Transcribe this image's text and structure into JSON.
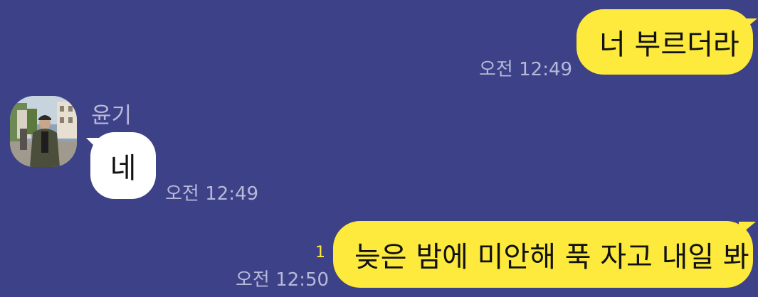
{
  "messages": [
    {
      "direction": "outgoing",
      "text": "너 부르더라",
      "time": "오전 12:49"
    },
    {
      "direction": "incoming",
      "sender": "윤기",
      "text": "네",
      "time": "오전 12:49"
    },
    {
      "direction": "outgoing",
      "text": "늦은 밤에 미안해 푹 자고 내일 봐",
      "time": "오전 12:50",
      "unread_count": "1"
    }
  ],
  "colors": {
    "background": "#3d4187",
    "outgoing_bubble": "#fdea3c",
    "incoming_bubble": "#ffffff",
    "timestamp": "#b7b9d9",
    "unread_badge": "#fdea3c"
  },
  "icons": {
    "avatar": "profile-photo"
  }
}
